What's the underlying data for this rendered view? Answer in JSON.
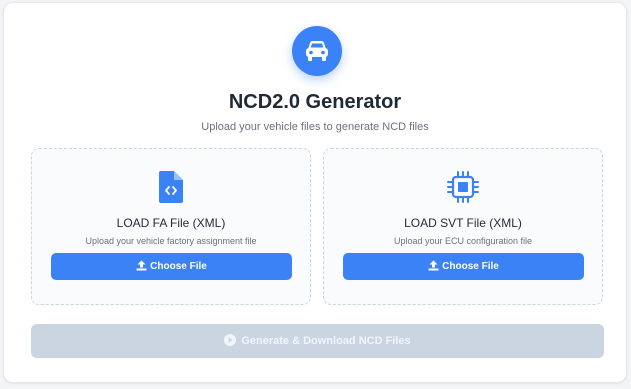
{
  "header": {
    "icon": "car-icon",
    "title": "NCD2.0 Generator",
    "subtitle": "Upload your vehicle files to generate NCD files"
  },
  "panels": [
    {
      "icon": "code-file-icon",
      "title": "LOAD FA File (XML)",
      "description": "Upload your vehicle factory assignment file",
      "button_label": "Choose File"
    },
    {
      "icon": "chip-icon",
      "title": "LOAD SVT File (XML)",
      "description": "Upload your ECU configuration file",
      "button_label": "Choose File"
    }
  ],
  "generate": {
    "label": "Generate & Download NCD Files",
    "icon": "play-circle-icon",
    "enabled": false
  },
  "colors": {
    "accent": "#3b82f6",
    "disabled_button": "#cbd5e1",
    "title_text": "#1f2937",
    "muted_text": "#6b7280"
  }
}
